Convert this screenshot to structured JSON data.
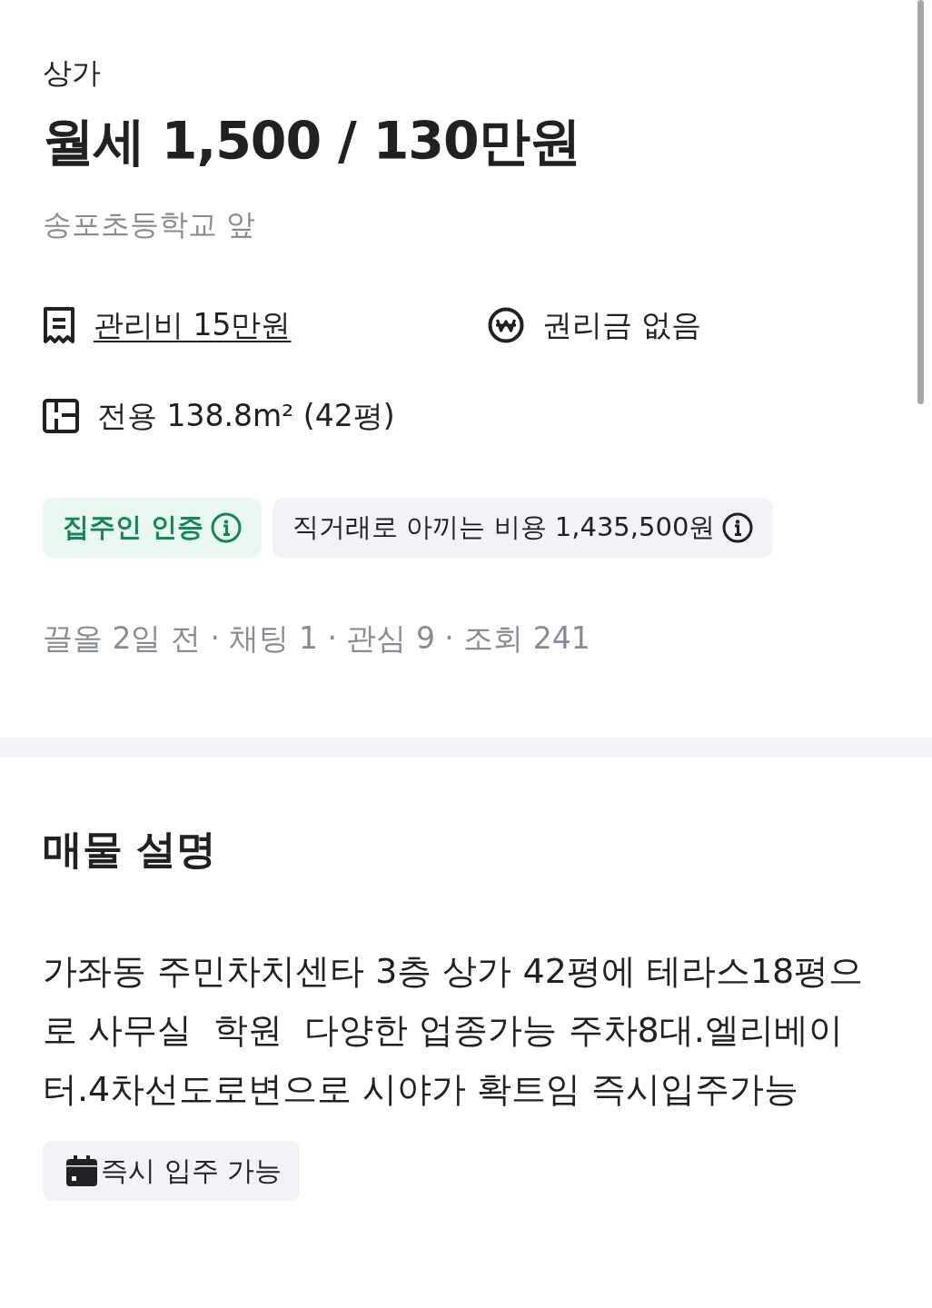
{
  "listing": {
    "category": "상가",
    "price": "월세 1,500 / 130만원",
    "location": "송포초등학교 앞"
  },
  "facts": [
    {
      "kind": "fee",
      "text": "관리비 15만원",
      "link": true
    },
    {
      "kind": "premium",
      "text": "권리금 없음",
      "link": false
    },
    {
      "kind": "area",
      "text": "전용 138.8m² (42평)",
      "link": false
    }
  ],
  "badges": [
    {
      "kind": "verified",
      "label": "집주인 인증"
    },
    {
      "kind": "neutral",
      "label": "직거래로 아끼는 비용 1,435,500원"
    }
  ],
  "stats": "끌올 2일 전 · 채팅 1 · 관심 9 · 조회 241",
  "description": {
    "title": "매물 설명",
    "body": "가좌동 주민차치센타 3층 상가 42평에 테라스18평으로 사무실  학원  다양한 업종가능 주차8대.엘리베이터.4차선도로변으로 시야가 확트임 즉시입주가능",
    "tags": [
      "즉시 입주 가능"
    ]
  }
}
